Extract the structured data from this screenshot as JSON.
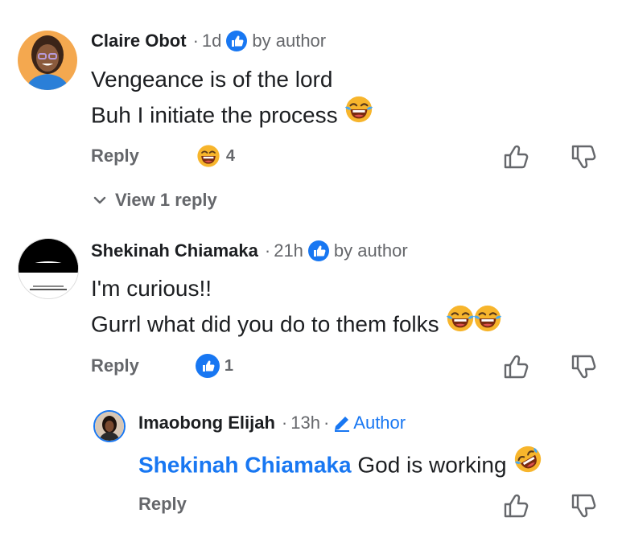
{
  "comments": [
    {
      "name": "Claire Obot",
      "time": "1d",
      "badge": "by author",
      "lines": [
        "Vengeance is of the lord",
        "Buh I initiate the process"
      ],
      "reply_label": "Reply",
      "reaction_count": "4",
      "view_replies": "View 1 reply"
    },
    {
      "name": "Shekinah Chiamaka",
      "time": "21h",
      "badge": "by author",
      "lines": [
        "I'm curious!!",
        "Gurrl what did you do to them folks"
      ],
      "reply_label": "Reply",
      "reaction_count": "1"
    }
  ],
  "reply": {
    "name": "Imaobong Elijah",
    "time": "13h",
    "badge": "Author",
    "mention": "Shekinah Chiamaka",
    "text": "God is working",
    "reply_label": "Reply"
  },
  "colors": {
    "accent": "#1877f2",
    "meta": "#65676b",
    "text": "#1c1e21"
  },
  "icons": [
    "like-badge-icon",
    "pencil-icon",
    "laughing-emoji-icon",
    "rofl-emoji-icon",
    "grin-emoji-icon",
    "thumbs-up-icon",
    "thumbs-down-icon",
    "chevron-down-icon"
  ]
}
